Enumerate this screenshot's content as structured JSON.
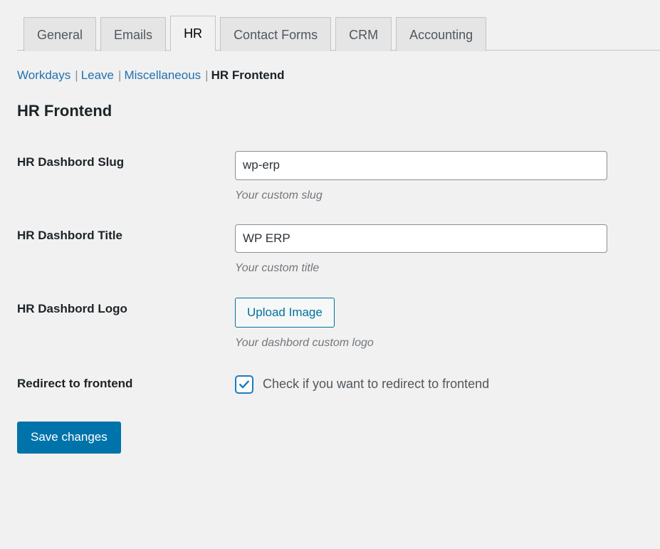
{
  "tabs": [
    {
      "label": "General",
      "active": false
    },
    {
      "label": "Emails",
      "active": false
    },
    {
      "label": "HR",
      "active": true
    },
    {
      "label": "Contact Forms",
      "active": false
    },
    {
      "label": "CRM",
      "active": false
    },
    {
      "label": "Accounting",
      "active": false
    }
  ],
  "subnav": {
    "items": [
      {
        "label": "Workdays",
        "current": false
      },
      {
        "label": "Leave",
        "current": false
      },
      {
        "label": "Miscellaneous",
        "current": false
      },
      {
        "label": "HR Frontend",
        "current": true
      }
    ],
    "separator": "|"
  },
  "page": {
    "title": "HR Frontend"
  },
  "form": {
    "slug": {
      "label": "HR Dashbord Slug",
      "value": "wp-erp",
      "placeholder": "",
      "help": "Your custom slug"
    },
    "title": {
      "label": "HR Dashbord Title",
      "value": "WP ERP",
      "placeholder": "",
      "help": "Your custom title"
    },
    "logo": {
      "label": "HR Dashbord Logo",
      "button_label": "Upload Image",
      "help": "Your dashbord custom logo"
    },
    "redirect": {
      "label": "Redirect to frontend",
      "checkbox_label": "Check if you want to redirect to frontend",
      "checked": true,
      "icon": "checkmark-icon"
    }
  },
  "actions": {
    "save_label": "Save changes"
  },
  "colors": {
    "accent": "#0073aa",
    "link": "#2271b1",
    "checkbox": "#1d7dbf",
    "upload_border": "#0071a1",
    "background": "#f1f1f1",
    "tab_inactive": "#e5e5e5"
  }
}
